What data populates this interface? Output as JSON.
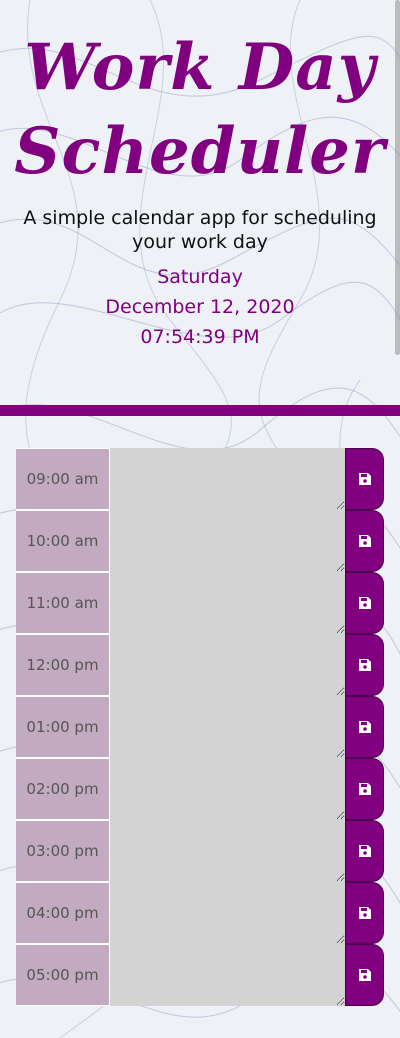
{
  "header": {
    "title_line1": "Work Day",
    "title_line2": "Scheduler",
    "subtitle": "A simple calendar app for scheduling your work day",
    "day": "Saturday",
    "date": "December 12, 2020",
    "time": "07:54:39 PM"
  },
  "colors": {
    "accent": "#800080",
    "hour_bg": "#c2aac1",
    "text_area_bg": "#d3d3d3"
  },
  "schedule": {
    "rows": [
      {
        "hour": "09:00 am",
        "text": "",
        "save_icon": "save-icon"
      },
      {
        "hour": "10:00 am",
        "text": "",
        "save_icon": "save-icon"
      },
      {
        "hour": "11:00 am",
        "text": "",
        "save_icon": "save-icon"
      },
      {
        "hour": "12:00 pm",
        "text": "",
        "save_icon": "save-icon"
      },
      {
        "hour": "01:00 pm",
        "text": "",
        "save_icon": "save-icon"
      },
      {
        "hour": "02:00 pm",
        "text": "",
        "save_icon": "save-icon"
      },
      {
        "hour": "03:00 pm",
        "text": "",
        "save_icon": "save-icon"
      },
      {
        "hour": "04:00 pm",
        "text": "",
        "save_icon": "save-icon"
      },
      {
        "hour": "05:00 pm",
        "text": "",
        "save_icon": "save-icon"
      }
    ]
  }
}
